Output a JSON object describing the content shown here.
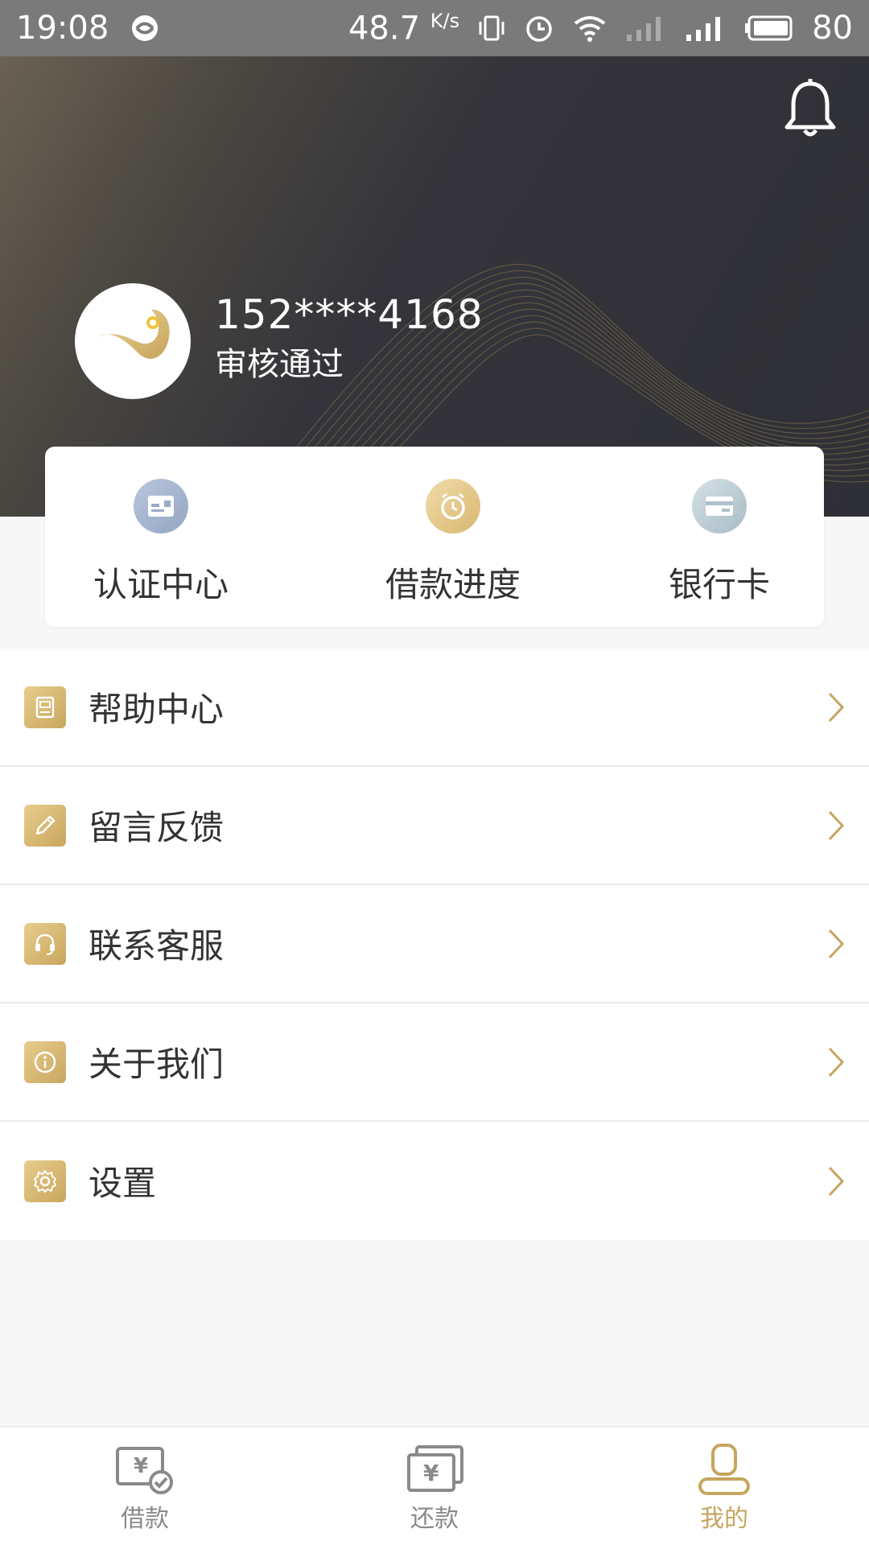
{
  "status_bar": {
    "time": "19:08",
    "net_speed": "48.7",
    "net_speed_unit": "K/s",
    "battery": "80"
  },
  "profile": {
    "phone": "152****4168",
    "status": "审核通过"
  },
  "quick_actions": [
    {
      "label": "认证中心",
      "icon": "id-card-icon"
    },
    {
      "label": "借款进度",
      "icon": "alarm-clock-icon"
    },
    {
      "label": "银行卡",
      "icon": "bank-card-icon"
    }
  ],
  "menu": [
    {
      "label": "帮助中心",
      "icon": "book-icon"
    },
    {
      "label": "留言反馈",
      "icon": "pencil-icon"
    },
    {
      "label": "联系客服",
      "icon": "headset-icon"
    },
    {
      "label": "关于我们",
      "icon": "info-icon"
    },
    {
      "label": "设置",
      "icon": "gear-icon"
    }
  ],
  "bottom_nav": [
    {
      "label": "借款",
      "icon": "loan-icon",
      "active": false
    },
    {
      "label": "还款",
      "icon": "repay-icon",
      "active": false
    },
    {
      "label": "我的",
      "icon": "user-icon",
      "active": true
    }
  ],
  "colors": {
    "accent_gold": "#c6a55e",
    "header_dark": "#2f3035",
    "status_bar": "#7a7a7a"
  }
}
